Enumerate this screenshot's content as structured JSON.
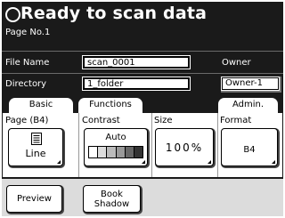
{
  "header": {
    "status": "Ready to scan data",
    "page_no": "Page No.1"
  },
  "info": {
    "file_name_label": "File Name",
    "file_name_value": "scan_0001",
    "directory_label": "Directory",
    "directory_value": "1_folder",
    "owner_label": "Owner",
    "owner_value": "Owner-1"
  },
  "tabs": {
    "basic": "Basic",
    "functions": "Functions",
    "admin": "Admin."
  },
  "settings": {
    "page_label": "Page (B4)",
    "page_value": "Line",
    "contrast_label": "Contrast",
    "contrast_value": "Auto",
    "contrast_colors": [
      "#ffffff",
      "#dddddd",
      "#bbbbbb",
      "#999999",
      "#666666",
      "#333333"
    ],
    "size_label": "Size",
    "size_value": "100%",
    "format_label": "Format",
    "format_value": "B4"
  },
  "actions": {
    "preview": "Preview",
    "book_shadow_line1": "Book",
    "book_shadow_line2": "Shadow"
  },
  "icons": {
    "status": "circle-status-icon",
    "page": "document-lines-icon"
  }
}
